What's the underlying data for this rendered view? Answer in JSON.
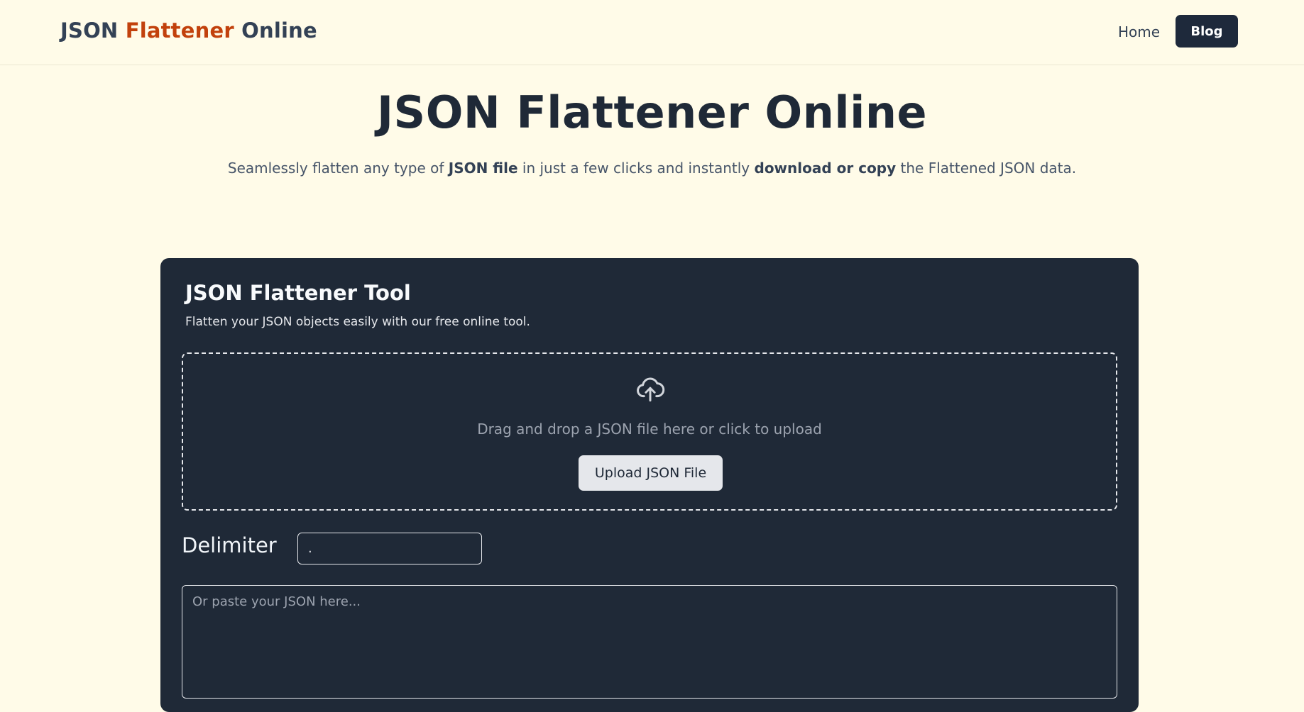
{
  "nav": {
    "brand_part1": "JSON ",
    "brand_accent": "Flattener",
    "brand_part2": " Online",
    "home_label": "Home",
    "blog_label": "Blog"
  },
  "hero": {
    "title": "JSON Flattener Online",
    "sub_1": "Seamlessly flatten any type of ",
    "sub_bold_1": "JSON file",
    "sub_2": " in just a few clicks and instantly ",
    "sub_bold_2": "download or copy",
    "sub_3": " the Flattened JSON data."
  },
  "tool": {
    "title": "JSON Flattener Tool",
    "description": "Flatten your JSON objects easily with our free online tool.",
    "dropzone_text": "Drag and drop a JSON file here or click to upload",
    "upload_button": "Upload JSON File",
    "delimiter_label": "Delimiter",
    "delimiter_value": ".",
    "json_placeholder": "Or paste your JSON here..."
  },
  "colors": {
    "background": "#fffbe8",
    "accent": "#c2410c",
    "dark": "#1e293b",
    "card": "#1f2937"
  },
  "icons": {
    "upload": "cloud-upload-icon"
  }
}
